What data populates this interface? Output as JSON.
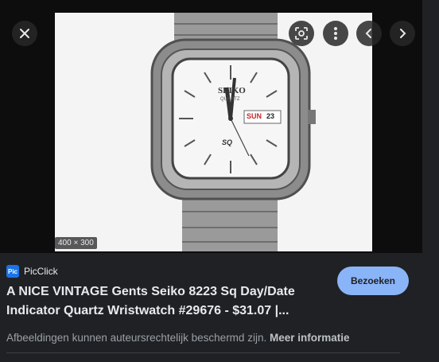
{
  "viewer": {
    "dimensions_badge": "400 × 300",
    "buttons": {
      "close": "close-icon",
      "lens": "lens-icon",
      "more": "more-vert-icon",
      "prev": "chevron-left-icon",
      "next": "chevron-right-icon"
    },
    "image_text": {
      "brand": "SEIKO",
      "sub": "QUARTZ",
      "day": "SUN",
      "date": "23",
      "logo": "SQ"
    }
  },
  "source": {
    "favicon_text": "Pic",
    "name": "PicClick"
  },
  "visit_button": "Bezoeken",
  "title": "A NICE VINTAGE Gents Seiko 8223 Sq Day/Date Indicator Quartz Wristwatch #29676 - $31.07 |...",
  "notice": {
    "text": "Afbeeldingen kunnen auteursrechtelijk beschermd zijn.",
    "link": "Meer informatie"
  },
  "colors": {
    "background": "#202124",
    "accent": "#8ab4f8",
    "favicon": "#1a73e8"
  }
}
